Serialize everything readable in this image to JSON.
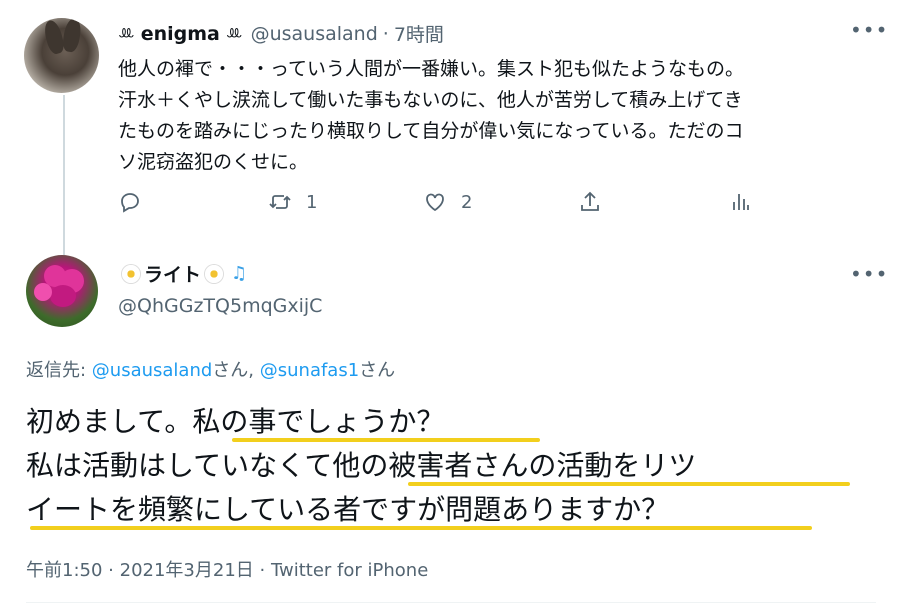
{
  "top_tweet": {
    "deco_left": "ꔛ",
    "display_name": "enigma",
    "deco_right": "ꔛ",
    "handle": "@usausaland",
    "dot": "·",
    "time": "7時間",
    "more": "•••",
    "lines": [
      "他人の褌で・・・っていう人間が一番嫌い。集スト犯も似たようなもの。",
      "汗水＋くやし涙流して働いた事もないのに、他人が苦労して積み上げてき",
      "たものを踏みにじったり横取りして自分が偉い気になっている。ただのコ",
      "ソ泥窃盗犯のくせに。"
    ],
    "actions": {
      "reply_icon": "reply-icon",
      "retweet_icon": "retweet-icon",
      "retweet_count": "1",
      "like_icon": "heart-icon",
      "like_count": "2",
      "share_icon": "share-icon",
      "analytics_icon": "analytics-icon"
    }
  },
  "main_tweet": {
    "display_name": "ライト",
    "note": "♫",
    "handle": "@QhGGzTQ5mqGxijC",
    "more": "•••",
    "reply_prefix": "返信先: ",
    "reply_user1": "@usausaland",
    "reply_mid": "さん, ",
    "reply_user2": "@sunafas1",
    "reply_suffix": "さん",
    "line1": "初めまして。私の事でしょうか？",
    "line2": "私は活動はしていなくて他の被害者さんの活動をリツ",
    "line3": "イートを頻繁にしている者ですが問題ありますか？",
    "time": "午前1:50",
    "dot": "·",
    "date": "2021年3月21日",
    "source": "Twitter for iPhone",
    "underline_color": "#f2cf1d"
  }
}
